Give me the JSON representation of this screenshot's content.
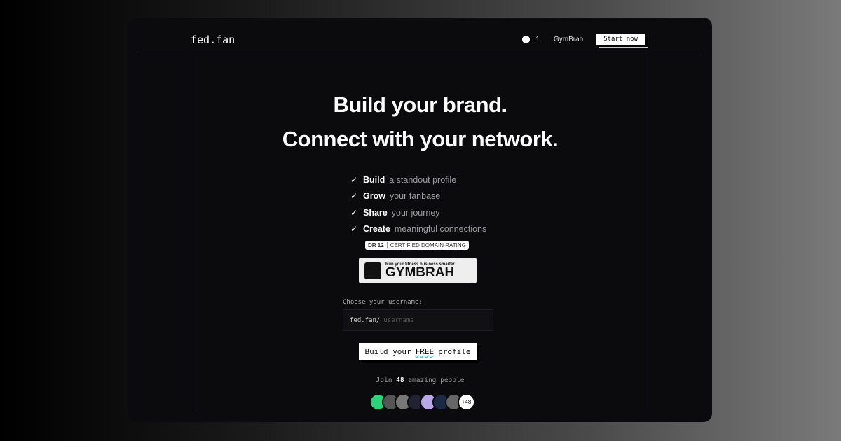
{
  "header": {
    "logo": "fed.fan",
    "github_count": "1",
    "nav_link": "GymBrah",
    "start_label": "Start now"
  },
  "hero": {
    "line1": "Build your brand.",
    "line2": "Connect with your network."
  },
  "features": [
    {
      "bold": "Build",
      "rest": "a standout profile"
    },
    {
      "bold": "Grow",
      "rest": "your fanbase"
    },
    {
      "bold": "Share",
      "rest": "your journey"
    },
    {
      "bold": "Create",
      "rest": "meaningful connections"
    }
  ],
  "badge": {
    "dr": "DR 12",
    "text": "CERTIFIED DOMAIN RATING"
  },
  "sponsor": {
    "tagline": "Run your fitness business smarter",
    "name": "GYMBRAH"
  },
  "form": {
    "label": "Choose your username:",
    "prefix": "fed.fan/",
    "placeholder": "username",
    "cta_pre": "Build your",
    "cta_free": "FREE",
    "cta_post": "profile"
  },
  "social": {
    "pre": "Join",
    "count": "48",
    "post": "amazing people",
    "more": "+48"
  },
  "avatar_colors": [
    "#2bd47a",
    "#555",
    "#777",
    "#223",
    "#b9a8e8",
    "#1a2a44",
    "#666"
  ]
}
